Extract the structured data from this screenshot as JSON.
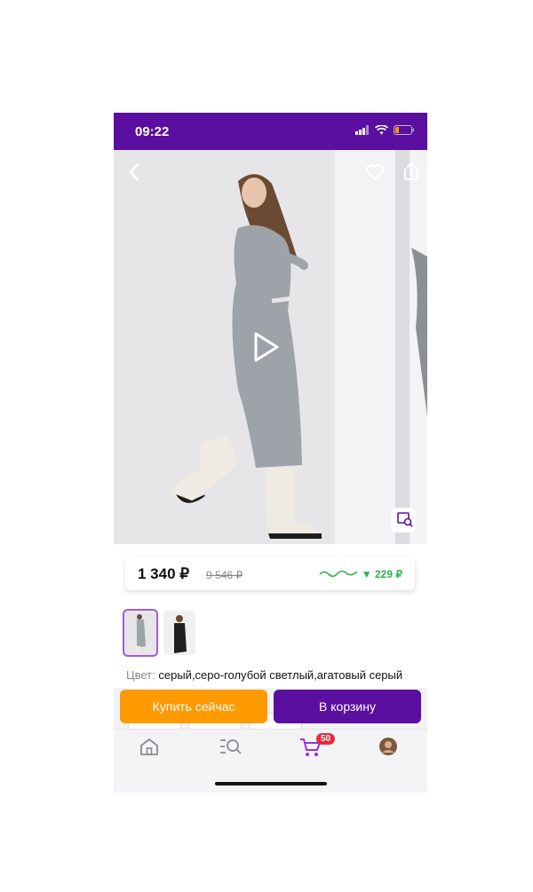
{
  "status_bar": {
    "time": "09:22"
  },
  "product": {
    "price_current": "1 340 ₽",
    "price_old": "9 546 ₽",
    "price_drop": "▼ 229 ₽",
    "color_label": "Цвет:",
    "color_value": "серый,серо-голубой светлый,агатовый серый"
  },
  "actions": {
    "buy_now": "Купить сейчас",
    "add_to_cart": "В корзину"
  },
  "tabbar": {
    "cart_count": "50"
  },
  "colors": {
    "brand_purple": "#5a0fa0",
    "buy_orange": "#ff9a00",
    "price_drop_green": "#2cb34a",
    "badge_red": "#e52b3c"
  },
  "icons": [
    "back-icon",
    "heart-icon",
    "share-icon",
    "play-icon",
    "image-search-icon",
    "home-icon",
    "catalog-search-icon",
    "cart-icon",
    "profile-icon"
  ]
}
